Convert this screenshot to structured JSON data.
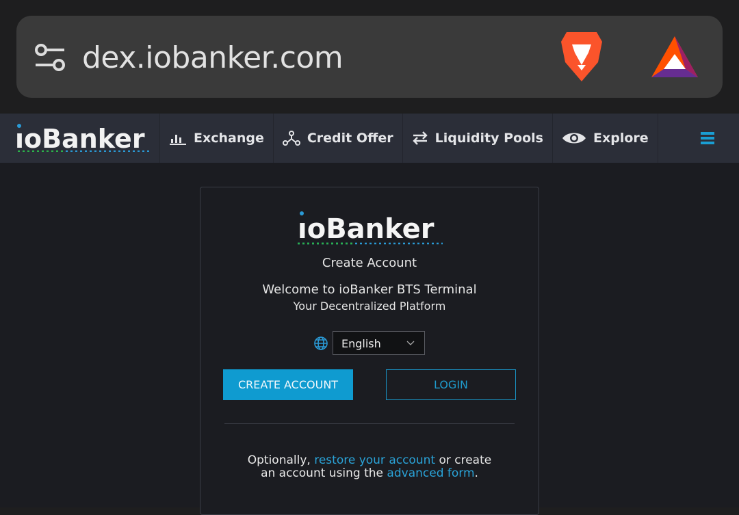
{
  "browser": {
    "url": "dex.iobanker.com",
    "icons": [
      "tune-icon",
      "brave-lion-icon",
      "bat-triangle-icon"
    ]
  },
  "nav": {
    "logo": "ioBanker",
    "items": [
      {
        "label": "Exchange",
        "icon": "bar-chart-icon"
      },
      {
        "label": "Credit Offer",
        "icon": "network-icon"
      },
      {
        "label": "Liquidity Pools",
        "icon": "swap-arrows-icon"
      },
      {
        "label": "Explore",
        "icon": "eye-icon"
      }
    ],
    "menu_icon": "hamburger-icon"
  },
  "card": {
    "logo": "ioBanker",
    "heading": "Create Account",
    "welcome": "Welcome to ioBanker BTS Terminal",
    "subtitle": "Your Decentralized Platform",
    "language": "English",
    "create_label": "CREATE ACCOUNT",
    "login_label": "LOGIN",
    "footer": {
      "t1": "Optionally, ",
      "link1": "restore your account",
      "t2": " or create an account using the ",
      "link2": "advanced form",
      "t3": "."
    }
  },
  "colors": {
    "accent": "#0f9bd0",
    "link": "#2aa3d8",
    "background": "#1b1c21",
    "navbar": "#2b2e38"
  }
}
